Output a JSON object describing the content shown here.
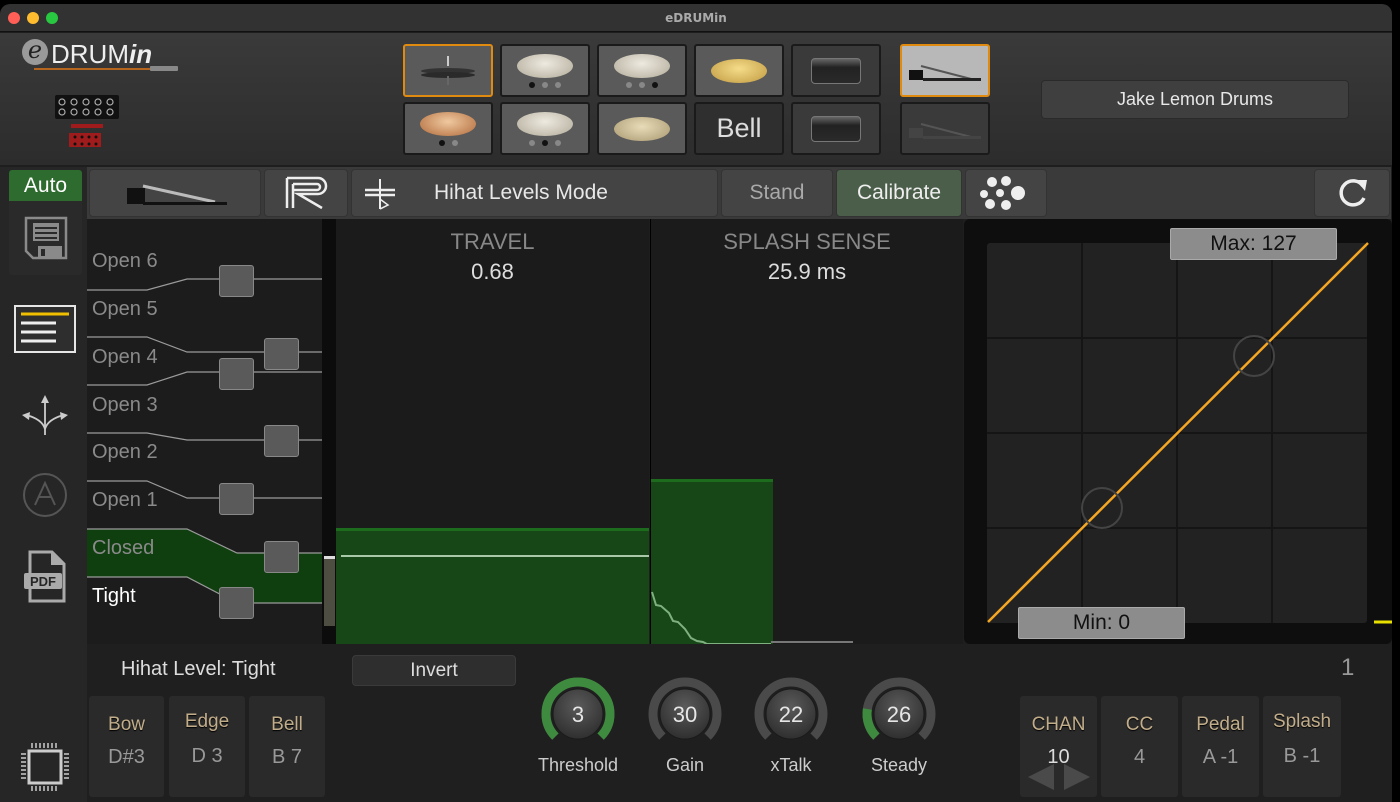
{
  "window": {
    "title": "eDRUMin"
  },
  "logo": {
    "prefix": "e",
    "text": "DRUM",
    "suffix": "in"
  },
  "header": {
    "kit_name": "Jake Lemon Drums",
    "pads_row1": [
      {
        "name": "hihat",
        "kind": "hihat",
        "selected": true
      },
      {
        "name": "ride-bow",
        "kind": "cymbal",
        "dots": [
          true,
          false,
          false
        ]
      },
      {
        "name": "ride-bell",
        "kind": "cymbal",
        "dots": [
          false,
          false,
          true
        ]
      },
      {
        "name": "gold-cymbal",
        "kind": "gold"
      },
      {
        "name": "snare-1",
        "kind": "drum"
      }
    ],
    "pads_row2": [
      {
        "name": "crash-copper",
        "kind": "crash",
        "dots": [
          true,
          false
        ]
      },
      {
        "name": "ride-mid",
        "kind": "cymbal",
        "dots": [
          false,
          true,
          false
        ]
      },
      {
        "name": "crash-light",
        "kind": "crash2"
      },
      {
        "name": "bell",
        "kind": "text",
        "label": "Bell"
      },
      {
        "name": "snare-2",
        "kind": "drum"
      }
    ],
    "pedal_top_selected": true
  },
  "toolbar": {
    "mode_label": "Hihat Levels Mode",
    "stand_label": "Stand",
    "calibrate_label": "Calibrate"
  },
  "sidebar": {
    "auto_label": "Auto",
    "pdf_label": "PDF"
  },
  "levels": {
    "items": [
      "Open 6",
      "Open 5",
      "Open 4",
      "Open 3",
      "Open 2",
      "Open 1",
      "Closed",
      "Tight"
    ],
    "current": "Tight"
  },
  "travel": {
    "title": "TRAVEL",
    "value": "0.68"
  },
  "splash": {
    "title": "SPLASH SENSE",
    "value": "25.9 ms"
  },
  "curve": {
    "max_label": "Max: 127",
    "min_label": "Min: 0",
    "color": "#f5a623"
  },
  "bottom": {
    "level_title": "Hihat Level: Tight",
    "invert_label": "Invert",
    "page_number": "1",
    "notes": [
      {
        "key": "Bow",
        "value": "D#3"
      },
      {
        "key": "Edge",
        "value": "D 3"
      },
      {
        "key": "Bell",
        "value": "B 7"
      }
    ],
    "knobs": [
      {
        "label": "Threshold",
        "value": "3",
        "fill": 1.0,
        "active": true
      },
      {
        "label": "Gain",
        "value": "30",
        "fill": 0.0,
        "active": false
      },
      {
        "label": "xTalk",
        "value": "22",
        "fill": 0.0,
        "active": false
      },
      {
        "label": "Steady",
        "value": "26",
        "fill": 0.2,
        "active": true
      }
    ],
    "midi": [
      {
        "key": "CHAN",
        "value": "10"
      },
      {
        "key": "CC",
        "value": "4"
      },
      {
        "key": "Pedal",
        "value": "A -1"
      },
      {
        "key": "Splash",
        "value": "B -1"
      }
    ]
  }
}
